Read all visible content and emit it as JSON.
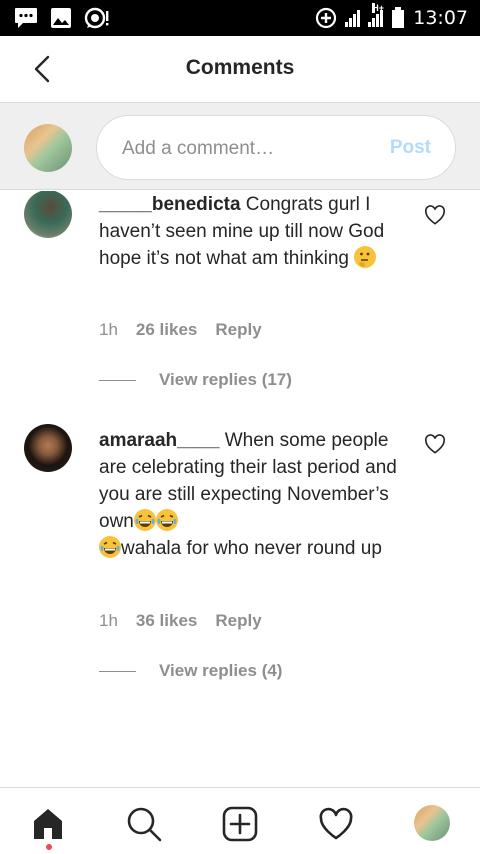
{
  "status_bar": {
    "time": "13:07",
    "network_label": "H+",
    "icons": [
      "chat-icon",
      "image-icon",
      "whatsapp-icon",
      "data-saver-icon",
      "signal-icon",
      "battery-icon"
    ]
  },
  "header": {
    "title": "Comments",
    "back_icon": "chevron-left-icon"
  },
  "composer": {
    "placeholder": "Add a comment…",
    "post_label": "Post"
  },
  "comments": [
    {
      "username": "_____benedicta",
      "text": " Congrats gurl I haven’t seen mine up till now God hope it’s not what am thinking ",
      "emoji": "thinking-face",
      "time": "1h",
      "likes": "26 likes",
      "reply_label": "Reply",
      "view_replies": "View replies (17)"
    },
    {
      "username": "amaraah____",
      "text_part1": " When some people are celebrating their last period and you are still expecting November’s own",
      "text_part2": "wahala for who never round up",
      "emoji": "grinning-face-with-tears",
      "time": "1h",
      "likes": "36 likes",
      "reply_label": "Reply",
      "view_replies": "View replies (4)"
    }
  ],
  "bottom_nav": {
    "items": [
      "home-icon",
      "search-icon",
      "add-post-icon",
      "activity-heart-icon",
      "profile-avatar"
    ]
  },
  "colors": {
    "text": "#262626",
    "muted": "#8e8e8e",
    "post_disabled": "#b3dbff",
    "notification_dot": "#ed4956"
  }
}
